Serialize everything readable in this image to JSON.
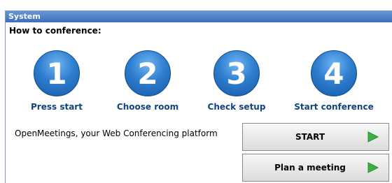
{
  "window": {
    "title": "System"
  },
  "heading": "How to conference:",
  "steps": [
    {
      "number": "1",
      "label": "Press start"
    },
    {
      "number": "2",
      "label": "Choose room"
    },
    {
      "number": "3",
      "label": "Check setup"
    },
    {
      "number": "4",
      "label": "Start conference"
    }
  ],
  "tagline": "OpenMeetings, your Web Conferencing platform",
  "buttons": {
    "start_label": "START",
    "plan_label": "Plan a meeting",
    "icon": "play-arrow-icon",
    "icon_color": "#3cb043"
  }
}
